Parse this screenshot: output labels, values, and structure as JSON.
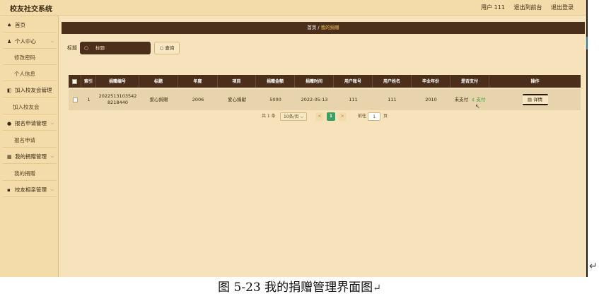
{
  "header": {
    "title": "校友社交系统",
    "user": "用户 111",
    "back_link": "退出到前台",
    "logout_link": "退出登录"
  },
  "sidebar": {
    "items": [
      {
        "label": "首页",
        "icon": "home-icon",
        "glyph": "♠",
        "type": "head"
      },
      {
        "label": "个人中心",
        "icon": "user-icon",
        "glyph": "♟",
        "type": "head",
        "chevron": true
      },
      {
        "label": "修改密码",
        "type": "sub"
      },
      {
        "label": "个人信息",
        "type": "sub"
      },
      {
        "label": "加入校友会管理",
        "icon": "thumb-icon",
        "glyph": "◧",
        "type": "head",
        "chevron": true
      },
      {
        "label": "加入校友会",
        "type": "sub"
      },
      {
        "label": "报名申请管理",
        "icon": "pin-icon",
        "glyph": "●",
        "type": "head",
        "chevron": true
      },
      {
        "label": "报名申请",
        "type": "sub"
      },
      {
        "label": "我的捐赠管理",
        "icon": "grid-icon",
        "glyph": "▦",
        "type": "head",
        "chevron": true
      },
      {
        "label": "我的捐赠",
        "type": "sub"
      },
      {
        "label": "校友相亲管理",
        "icon": "apps-icon",
        "glyph": "▪",
        "type": "head",
        "chevron": true
      }
    ]
  },
  "breadcrumb": {
    "home": "首页",
    "sep": " / ",
    "current": "我的捐赠"
  },
  "search": {
    "label": "标题",
    "placeholder": "标题",
    "button": "查询",
    "button_icon": "○"
  },
  "table": {
    "columns": [
      "",
      "索引",
      "捐赠编号",
      "标题",
      "年度",
      "项目",
      "捐赠金额",
      "捐赠时间",
      "用户账号",
      "用户姓名",
      "毕业年份",
      "是否支付",
      "操作"
    ],
    "rows": [
      {
        "index": "1",
        "code": "20225131035428218440",
        "title": "爱心捐赠",
        "year": "2006",
        "project": "爱心捐献",
        "amount": "5000",
        "time": "2022-05-13",
        "account": "111",
        "name": "111",
        "grad_year": "2010",
        "paid_status": "未支付",
        "pay_action": "支付",
        "detail": "详情"
      }
    ]
  },
  "pagination": {
    "total": "共 1 条",
    "page_size": "10条/页",
    "prev": "<",
    "current": "1",
    "next": ">",
    "goto_label": "前往",
    "goto_value": "1",
    "page_unit": "页"
  },
  "caption": {
    "text": "图 5-23 我的捐赠管理界面图"
  }
}
